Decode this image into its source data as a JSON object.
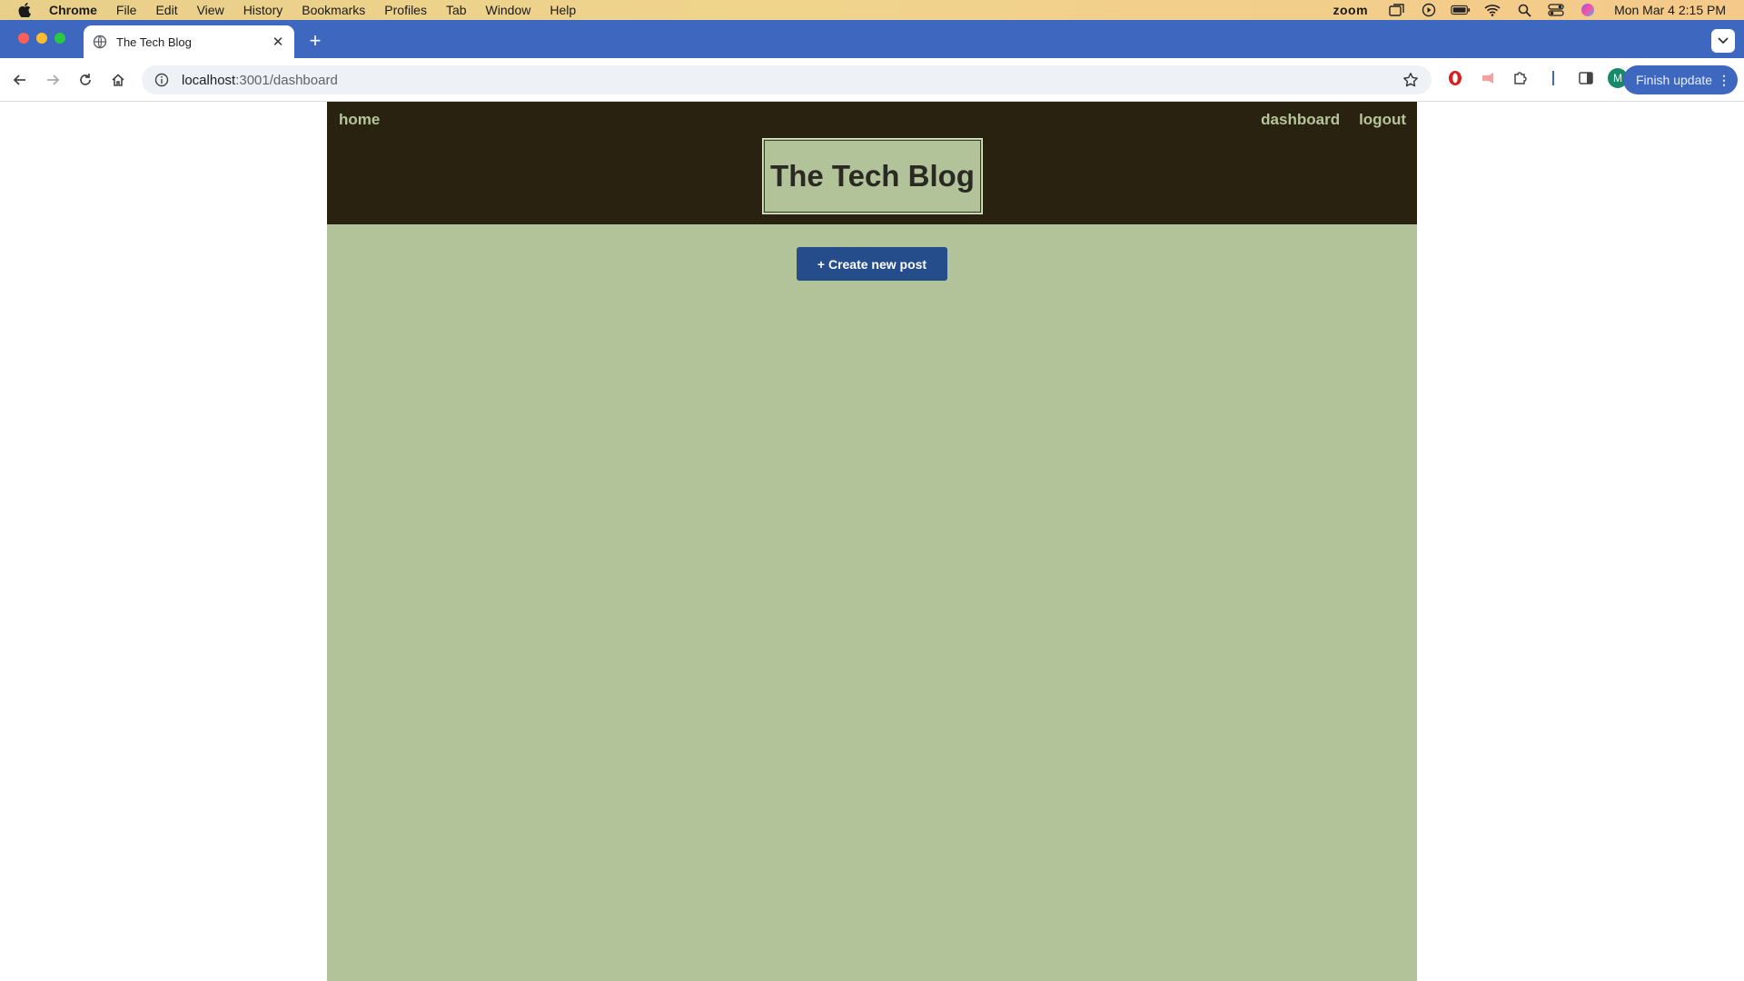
{
  "os_menubar": {
    "app_name": "Chrome",
    "menus": [
      "File",
      "Edit",
      "View",
      "History",
      "Bookmarks",
      "Profiles",
      "Tab",
      "Window",
      "Help"
    ],
    "zoom_label": "zoom",
    "clock": "Mon Mar 4  2:15 PM"
  },
  "browser": {
    "tab_title": "The Tech Blog",
    "url_host": "localhost",
    "url_path": ":3001/dashboard",
    "profile_initial": "M",
    "finish_update_label": "Finish update"
  },
  "page": {
    "nav": {
      "home": "home",
      "dashboard": "dashboard",
      "logout": "logout"
    },
    "title": "The Tech Blog",
    "create_button": "+ Create new post"
  },
  "colors": {
    "header_bg": "#2a2210",
    "page_bg": "#b2c399",
    "nav_link": "#b5c59b",
    "button_bg": "#254d8c",
    "tabstrip_bg": "#3e67c0"
  }
}
